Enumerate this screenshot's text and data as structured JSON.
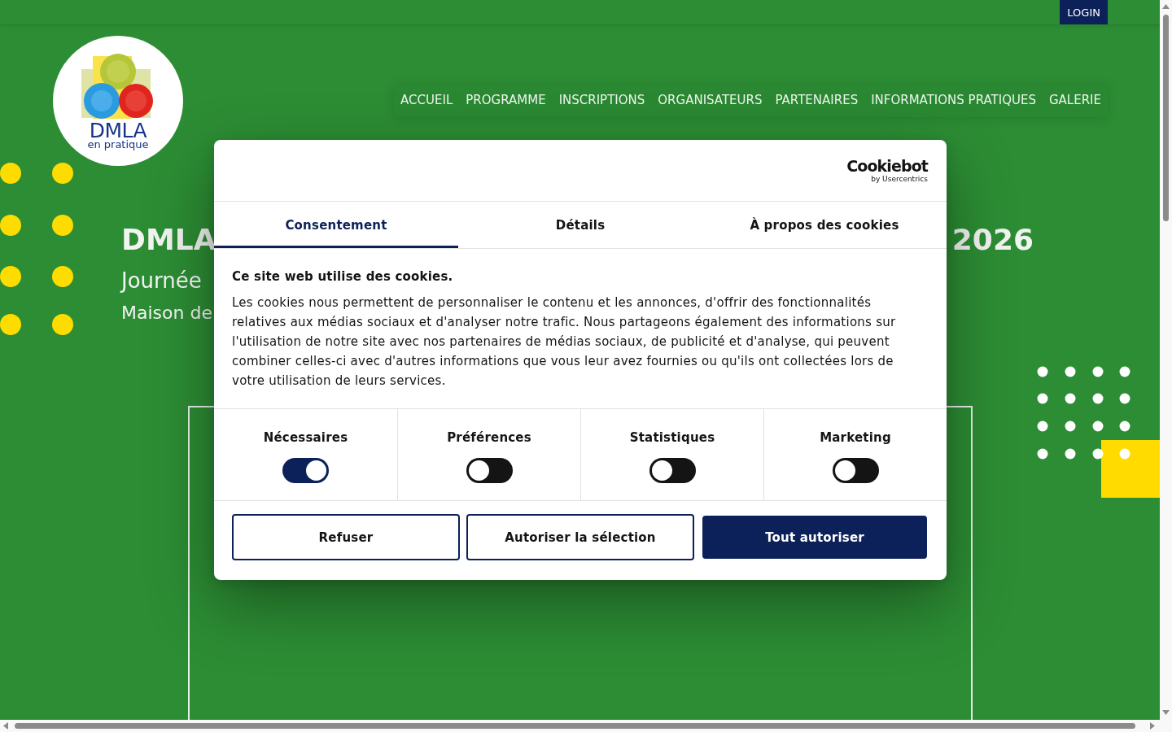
{
  "top_bar": {
    "login_button": "LOGIN"
  },
  "logo": {
    "title": "DMLA",
    "tagline": "en pratique"
  },
  "nav": [
    "ACCUEIL",
    "PROGRAMME",
    "INSCRIPTIONS",
    "ORGANISATEURS",
    "PARTENAIRES",
    "INFORMATIONS PRATIQUES",
    "GALERIE"
  ],
  "hero": {
    "title_parts": [
      "DMLA",
      "2026"
    ],
    "subtitle": "Journée",
    "location": "Maison de"
  },
  "cookie_dialog": {
    "brand": {
      "name": "Cookiebot",
      "tagline": "by Usercentrics"
    },
    "tabs": [
      {
        "label": "Consentement",
        "selected": true
      },
      {
        "label": "Détails",
        "selected": false
      },
      {
        "label": "À propos des cookies",
        "selected": false
      }
    ],
    "heading": "Ce site web utilise des cookies.",
    "text": "Les cookies nous permettent de personnaliser le contenu et les annonces, d'offrir des fonctionnalités relatives aux médias sociaux et d'analyser notre trafic. Nous partageons également des informations sur l'utilisation de notre site avec nos partenaires de médias sociaux, de publicité et d'analyse, qui peuvent combiner celles-ci avec d'autres informations que vous leur avez fournies ou qu'ils ont collectées lors de votre utilisation de leurs services.",
    "categories": [
      {
        "label": "Nécessaires",
        "on": true
      },
      {
        "label": "Préférences",
        "on": false
      },
      {
        "label": "Statistiques",
        "on": false
      },
      {
        "label": "Marketing",
        "on": false
      }
    ],
    "buttons": [
      {
        "label": "Refuser",
        "kind": "outline"
      },
      {
        "label": "Autoriser la sélection",
        "kind": "outline"
      },
      {
        "label": "Tout autoriser",
        "kind": "primary"
      }
    ]
  }
}
